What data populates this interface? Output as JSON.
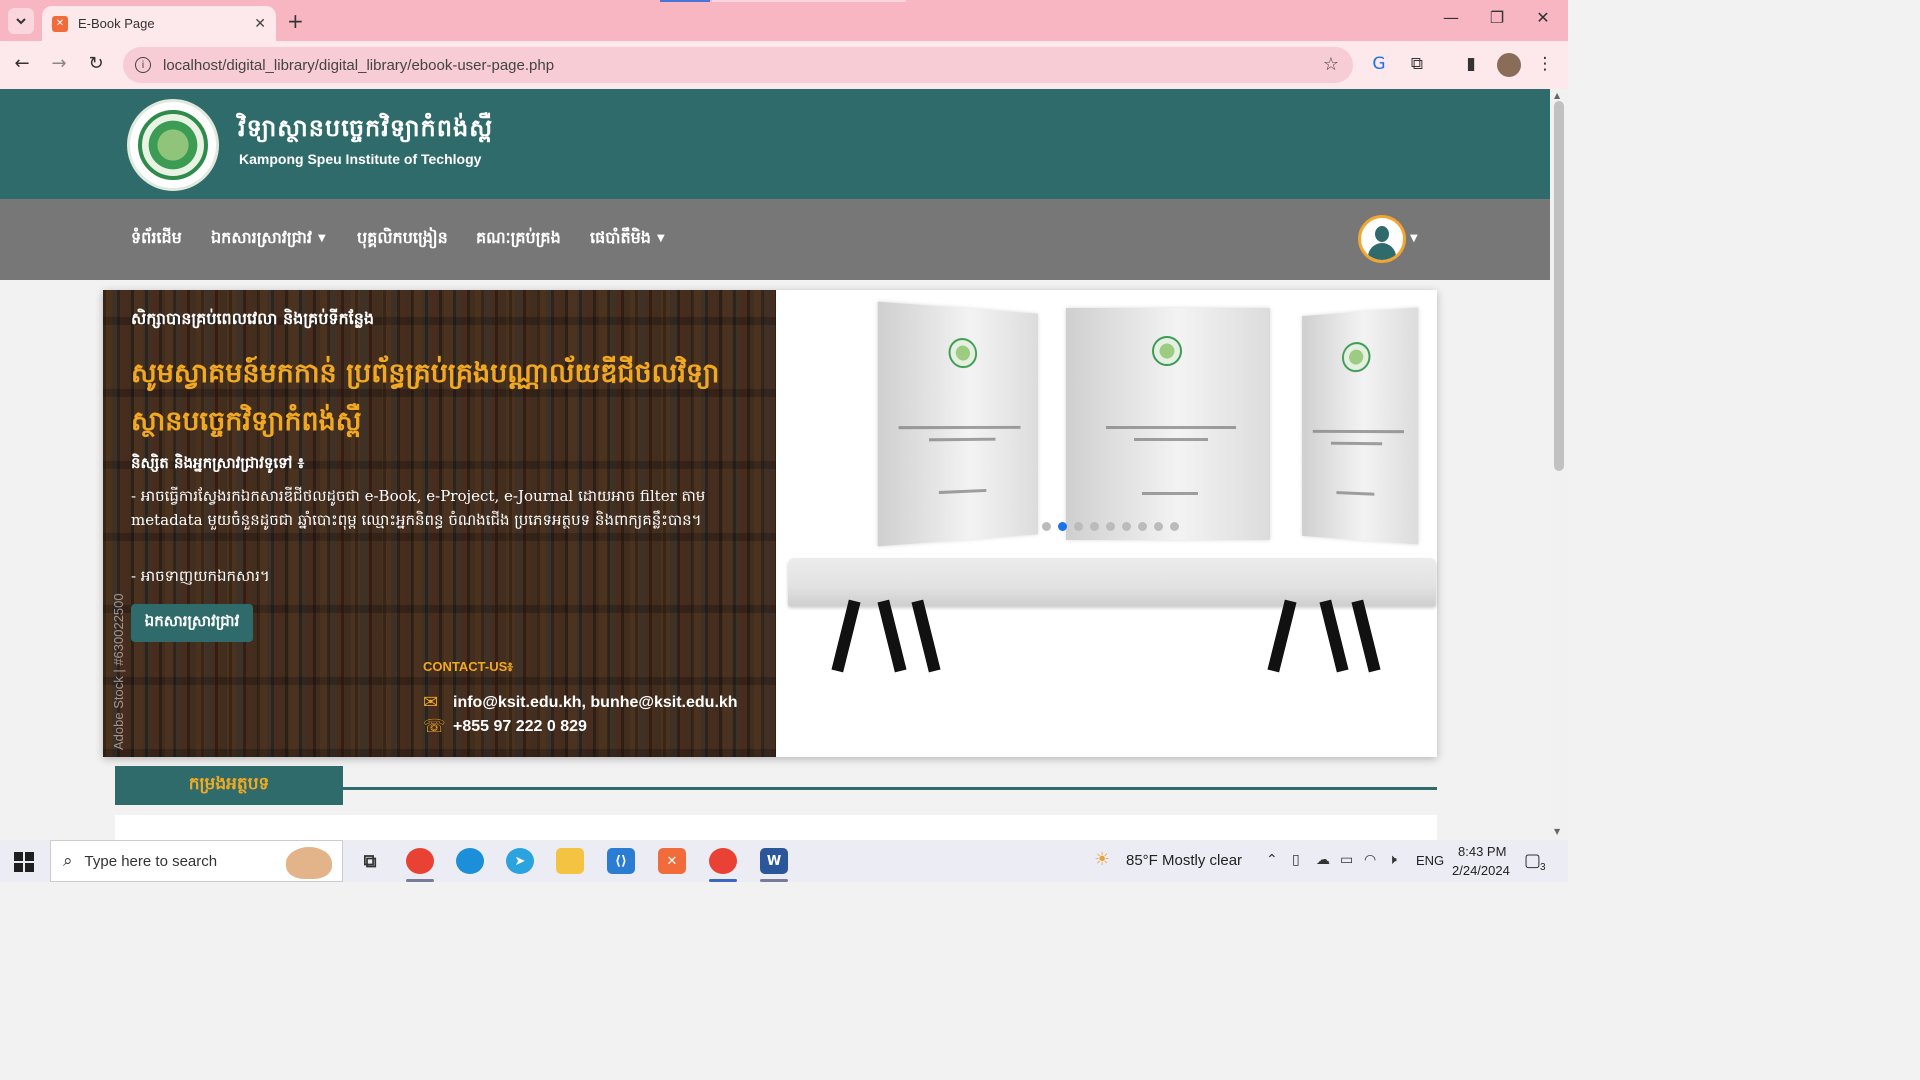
{
  "browser": {
    "tab_title": "E-Book Page",
    "url": "localhost/digital_library/digital_library/ebook-user-page.php"
  },
  "site": {
    "name_km": "វិទ្យាស្ថានបច្ចេកវិទ្យាកំពង់ស្ពឺ",
    "name_en": "Kampong Speu Institute of Techlogy",
    "nav": [
      {
        "label": "ទំព័រដើម"
      },
      {
        "label": "ឯកសារស្រាវជ្រាវ",
        "dropdown": true
      },
      {
        "label": "បុគ្គលិកបង្រៀន"
      },
      {
        "label": "គណៈគ្រប់គ្រង"
      },
      {
        "label": "ផេបាំតឹមិង",
        "dropdown": true
      }
    ]
  },
  "hero": {
    "tagline": "សិក្សាបានគ្រប់ពេលវេលា និងគ្រប់ទីកន្លែង",
    "title": "សូមស្វាគមន៍មកកាន់  ប្រព័ន្ធគ្រប់គ្រងបណ្ណាល័យឌីជីថលវិទ្យាស្ថានបច្ចេកវិទ្យាកំពង់ស្ពឺ",
    "audience": "និស្សិត និងអ្នកស្រាវជ្រាវទូទៅ ៖",
    "desc1": "- អាចធ្វើការស្វែងរកឯកសារឌីជីថលដូចជា e-Book, e-Project, e-Journal ដោយអាច filter តាម metadata មួយចំនួនដូចជា ឆ្នាំបោះពុម្ព ឈ្មោះអ្នកនិពន្ធ ចំណងជើង ប្រភេទអត្ថបទ និងពាក្យគន្លឹះបាន។",
    "desc2": "- អាចទាញយកឯកសារ។",
    "button": "ឯកសារស្រាវជ្រាវ",
    "watermark": "Adobe Stock | #630022500",
    "contact_label": "CONTACT-US៖",
    "email": "info@ksit.edu.kh, bunhe@ksit.edu.kh",
    "phone": "+855 97 222 0 829",
    "carousel_total": 9,
    "carousel_active": 2
  },
  "section": {
    "title": "កម្រងអត្ថបទ"
  },
  "taskbar": {
    "search_placeholder": "Type here to search",
    "weather": "85°F  Mostly clear",
    "lang": "ENG",
    "time": "8:43 PM",
    "date": "2/24/2024",
    "notifications": "3"
  },
  "colors": {
    "brand_teal": "#2f6b6b",
    "nav_gray": "#777777",
    "accent_orange": "#f2a922",
    "tab_bar_pink": "#f7b6c2"
  }
}
